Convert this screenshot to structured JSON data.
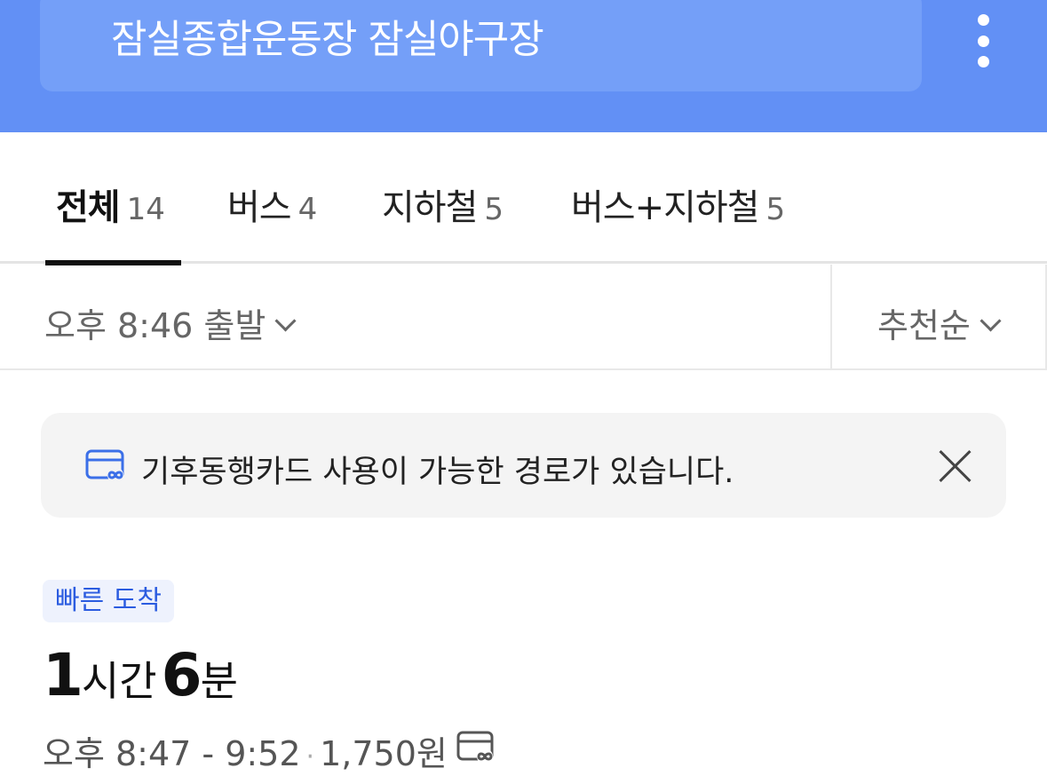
{
  "header": {
    "destination": "잠실종합운동장 잠실야구장",
    "more_icon": "more-vertical-icon"
  },
  "tabs": [
    {
      "label": "전체",
      "count": "14",
      "active": true
    },
    {
      "label": "버스",
      "count": "4",
      "active": false
    },
    {
      "label": "지하철",
      "count": "5",
      "active": false
    },
    {
      "label": "버스+지하철",
      "count": "5",
      "active": false
    }
  ],
  "filter": {
    "departure": "오후 8:46 출발",
    "sort": "추천순"
  },
  "notice": {
    "text": "기후동행카드 사용이 가능한 경로가 있습니다.",
    "icon": "climate-card-icon"
  },
  "route": {
    "badge": "빠른 도착",
    "hours": "1",
    "hours_unit": "시간",
    "minutes": "6",
    "minutes_unit": "분",
    "time_range": "오후 8:47 - 9:52",
    "separator": "·",
    "fare": "1,750원"
  },
  "colors": {
    "header_bg": "#6290f5",
    "accent_blue": "#2b5ce0",
    "card_icon": "#3b6fe8"
  }
}
